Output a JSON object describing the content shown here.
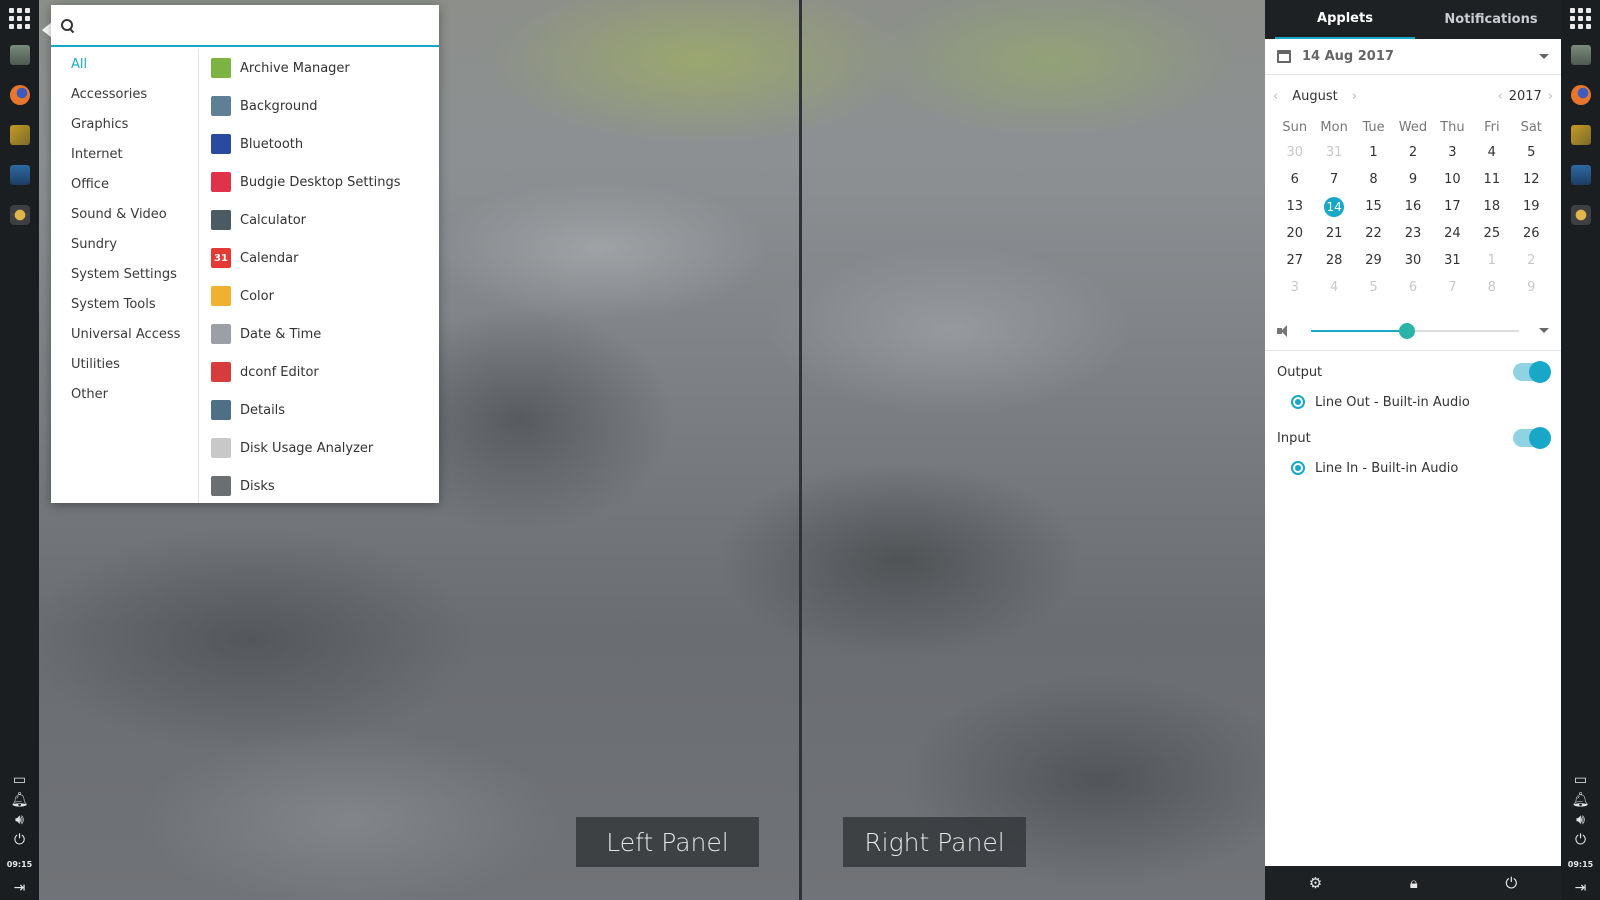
{
  "labels": {
    "left_panel": "Left Panel",
    "right_panel": "Right Panel"
  },
  "dock": {
    "clock": "09:15"
  },
  "menu": {
    "search": {
      "value": "",
      "placeholder": ""
    },
    "categories": [
      "All",
      "Accessories",
      "Graphics",
      "Internet",
      "Office",
      "Sound & Video",
      "Sundry",
      "System Settings",
      "System Tools",
      "Universal Access",
      "Utilities",
      "Other"
    ],
    "active_category": "All",
    "apps": [
      {
        "label": "Archive Manager",
        "icon": "archive-manager-icon",
        "color": "#7cb342"
      },
      {
        "label": "Background",
        "icon": "background-icon",
        "color": "#5f7f96"
      },
      {
        "label": "Bluetooth",
        "icon": "bluetooth-icon",
        "color": "#2a4aa0"
      },
      {
        "label": "Budgie Desktop Settings",
        "icon": "budgie-settings-icon",
        "color": "#e0324a"
      },
      {
        "label": "Calculator",
        "icon": "calculator-icon",
        "color": "#4b5a63"
      },
      {
        "label": "Calendar",
        "icon": "calendar-icon",
        "color": "#e53935",
        "glyph": "31"
      },
      {
        "label": "Color",
        "icon": "color-icon",
        "color": "#f0b030"
      },
      {
        "label": "Date & Time",
        "icon": "clock-icon",
        "color": "#9aa0a6"
      },
      {
        "label": "dconf Editor",
        "icon": "dconf-editor-icon",
        "color": "#d83b3b"
      },
      {
        "label": "Details",
        "icon": "gear-icon",
        "color": "#4f6f86"
      },
      {
        "label": "Disk Usage Analyzer",
        "icon": "disk-usage-icon",
        "color": "#c8c8c8"
      },
      {
        "label": "Disks",
        "icon": "disks-icon",
        "color": "#6b6f73"
      }
    ]
  },
  "raven": {
    "tabs": [
      "Applets",
      "Notifications"
    ],
    "active_tab": "Applets",
    "date_header": "14 Aug 2017",
    "calendar": {
      "month": "August",
      "year": "2017",
      "weekdays": [
        "Sun",
        "Mon",
        "Tue",
        "Wed",
        "Thu",
        "Fri",
        "Sat"
      ],
      "weeks": [
        [
          "30",
          "31",
          "1",
          "2",
          "3",
          "4",
          "5"
        ],
        [
          "6",
          "7",
          "8",
          "9",
          "10",
          "11",
          "12"
        ],
        [
          "13",
          "14",
          "15",
          "16",
          "17",
          "18",
          "19"
        ],
        [
          "20",
          "21",
          "22",
          "23",
          "24",
          "25",
          "26"
        ],
        [
          "27",
          "28",
          "29",
          "30",
          "31",
          "1",
          "2"
        ],
        [
          "3",
          "4",
          "5",
          "6",
          "7",
          "8",
          "9"
        ]
      ],
      "dim_first_week_count": 2,
      "dim_from_week4_index": 5,
      "today": "14"
    },
    "volume": {
      "level": 0.46
    },
    "output": {
      "label": "Output",
      "device": "Line Out - Built-in Audio",
      "enabled": true
    },
    "input": {
      "label": "Input",
      "device": "Line In - Built-in Audio",
      "enabled": true
    },
    "accent": "#19a7c8"
  }
}
